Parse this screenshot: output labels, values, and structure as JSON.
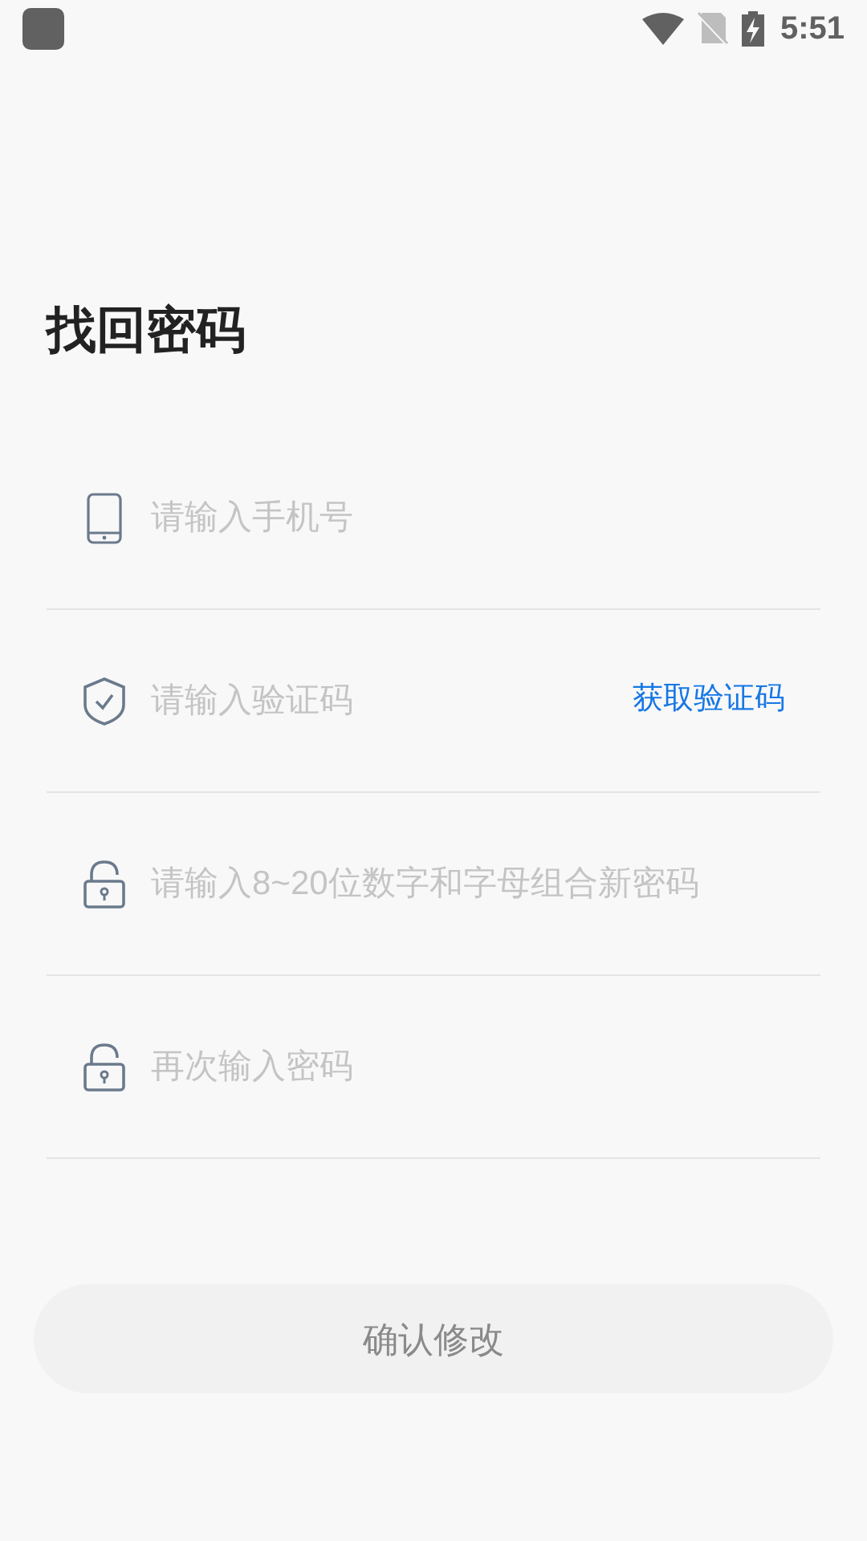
{
  "status_bar": {
    "time": "5:51"
  },
  "title": "找回密码",
  "fields": [
    {
      "kind": "phone",
      "placeholder": "请输入手机号"
    },
    {
      "kind": "code",
      "placeholder": "请输入验证码",
      "action": "获取验证码"
    },
    {
      "kind": "password",
      "placeholder": "请输入8~20位数字和字母组合新密码"
    },
    {
      "kind": "password",
      "placeholder": "再次输入密码"
    }
  ],
  "submit_button": {
    "label": "确认修改",
    "disabled": true
  }
}
